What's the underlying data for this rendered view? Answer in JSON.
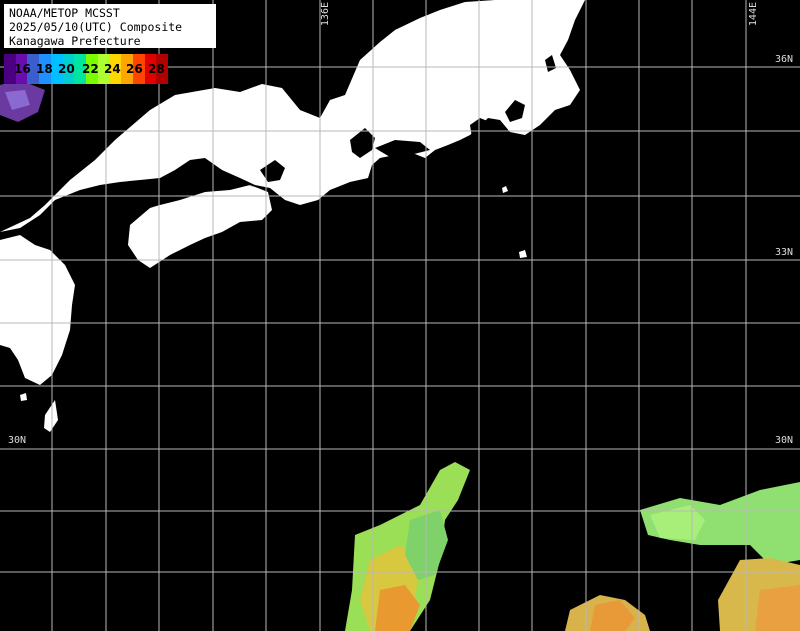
{
  "header": {
    "line1": "NOAA/METOP MCSST",
    "line2": "2025/05/10(UTC) Composite",
    "line3": "Kanagawa Prefecture"
  },
  "legend": {
    "labels": [
      "16",
      "18",
      "20",
      "22",
      "24",
      "26",
      "28"
    ],
    "colors": [
      "#4b0082",
      "#6a0dad",
      "#3a5fcd",
      "#1e90ff",
      "#00bfff",
      "#00ced1",
      "#00e5a0",
      "#7cfc00",
      "#adff2f",
      "#ffd700",
      "#ffa500",
      "#ff4500",
      "#e00000",
      "#b00000"
    ]
  },
  "grid": {
    "lon_labels": [
      "136E",
      "144E"
    ],
    "lat_labels": [
      "36N",
      "33N",
      "30N",
      "30N"
    ]
  },
  "colors": {
    "land": "#ffffff",
    "sea_nodata": "#000000",
    "grid": "#b8b8b8"
  }
}
